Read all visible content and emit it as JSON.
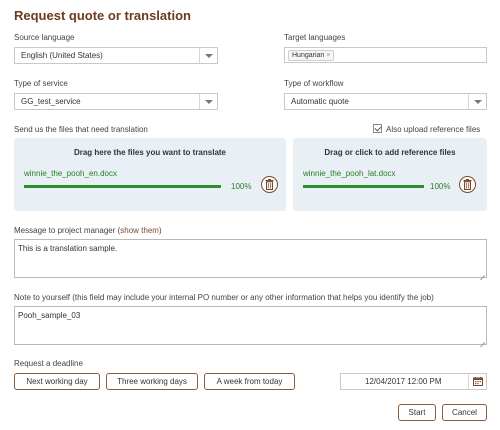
{
  "title": "Request quote or translation",
  "source_language": {
    "label": "Source language",
    "value": "English (United States)"
  },
  "target_languages": {
    "label": "Target languages",
    "tags": [
      "Hungarian"
    ]
  },
  "service": {
    "label": "Type of service",
    "value": "GG_test_service"
  },
  "workflow": {
    "label": "Type of workflow",
    "value": "Automatic quote"
  },
  "files": {
    "label": "Send us the files that need translation",
    "reference_checkbox_label": "Also upload reference files",
    "reference_checked": true,
    "translate_zone": {
      "heading": "Drag here the files you want to translate",
      "file": "winnie_the_pooh_en.docx",
      "progress": "100%"
    },
    "reference_zone": {
      "heading": "Drag or click to add reference files",
      "file": "winnie_the_pooh_lat.docx",
      "progress": "100%"
    }
  },
  "message": {
    "label": "Message to project manager (",
    "link": "show them",
    "label_end": ")",
    "value": "This is a translation sample."
  },
  "note": {
    "label": "Note to yourself (this field may include your internal PO number or any other information that helps you identify the job)",
    "value": "Pooh_sample_03"
  },
  "deadline": {
    "label": "Request a deadline",
    "options": [
      "Next working day",
      "Three working days",
      "A week from today"
    ],
    "value": "12/04/2017 12:00 PM"
  },
  "actions": {
    "start": "Start",
    "cancel": "Cancel"
  },
  "colors": {
    "accent": "#6e3b1d",
    "progress": "#2e8b2e",
    "dropzone_bg": "#e9f0f5"
  },
  "icons": {
    "select_arrow": "chevron-down-icon",
    "delete": "trash-icon",
    "calendar": "calendar-icon",
    "tag_remove": "close-icon"
  }
}
